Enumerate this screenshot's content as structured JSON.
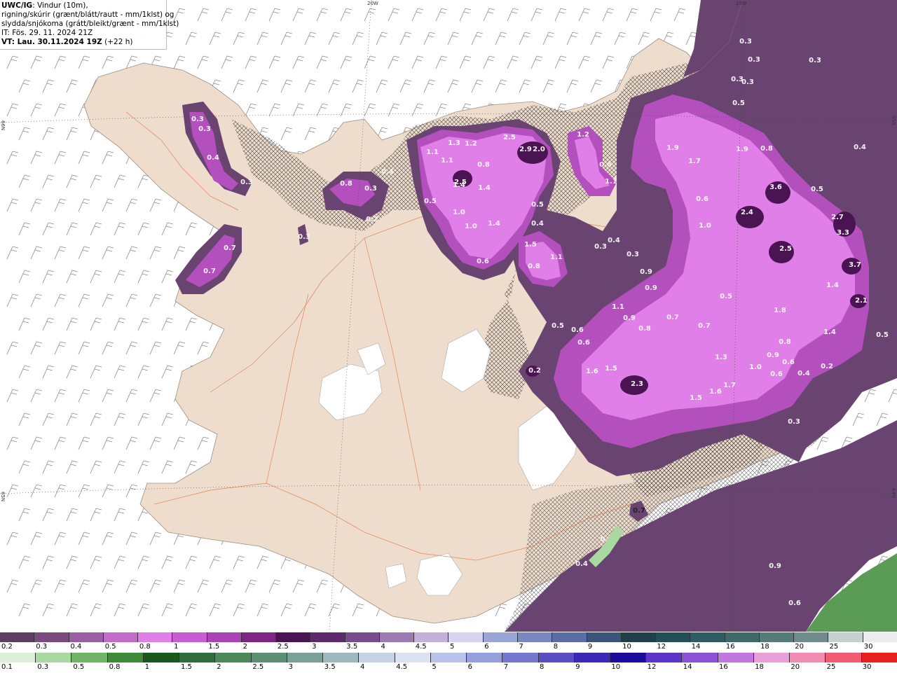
{
  "header": {
    "line1_bold": "UWC/IG",
    "line1_rest": ": Vindur (10m),",
    "line2": "rigning/skúrir (grænt/blátt/rautt - mm/1klst) og",
    "line3": "slydda/snjókoma (grátt/bleikt/grænt - mm/1klst)",
    "line4": "IT: Fös. 29. 11. 2024 21Z",
    "line5_bold": "VT: Lau. 30.11.2024 19Z",
    "line5_rest": " (+22 h)"
  },
  "graticule": {
    "top": [
      "20W",
      "15W"
    ],
    "left": [
      "66N",
      "65N"
    ],
    "right": [
      "65N",
      "64N"
    ]
  },
  "legend": {
    "top_labels": [
      "0.2",
      "0.3",
      "0.4",
      "0.5",
      "0.8",
      "1",
      "1.5",
      "2",
      "2.5",
      "3",
      "3.5",
      "4",
      "4.5",
      "5",
      "6",
      "7",
      "8",
      "9",
      "10",
      "12",
      "14",
      "16",
      "18",
      "20",
      "25",
      "30"
    ],
    "top_colors": [
      "#5e3d62",
      "#7a4b7f",
      "#9a5fa0",
      "#c36dcb",
      "#e07fe8",
      "#c65ed3",
      "#a944b6",
      "#7e2685",
      "#4a1452",
      "#5d2a6b",
      "#7a4c8d",
      "#9b7bb2",
      "#c3b0db",
      "#d9d2f0",
      "#9aa6d6",
      "#7b87c0",
      "#5b6da6",
      "#3c5479",
      "#203f4a",
      "#244f59",
      "#2f5d63",
      "#406a6a",
      "#577a7a",
      "#708b8b",
      "#c7cfcf",
      "#e9eded"
    ],
    "bottom_labels": [
      "0.1",
      "0.3",
      "0.5",
      "0.8",
      "1",
      "1.5",
      "2",
      "2.5",
      "3",
      "3.5",
      "4",
      "4.5",
      "5",
      "6",
      "7",
      "8",
      "9",
      "10",
      "12",
      "14",
      "16",
      "18",
      "20",
      "25",
      "30"
    ],
    "bottom_colors": [
      "#dff0d8",
      "#a9d8a0",
      "#6fb565",
      "#3e8a38",
      "#195a1c",
      "#2f6e3a",
      "#4b8a58",
      "#5e8f75",
      "#7aa097",
      "#9fb8bd",
      "#c4d3e2",
      "#dbe2f1",
      "#b9c2ea",
      "#959fde",
      "#7377cf",
      "#5a4fc2",
      "#3a2ab5",
      "#1b0c9e",
      "#5a35c7",
      "#8d50d8",
      "#c277e0",
      "#e8a0d8",
      "#f08db0",
      "#f05c72",
      "#e8201e"
    ]
  },
  "precip_labels": [
    "0.3",
    "0.3",
    "0.4",
    "0.3",
    "0.7",
    "0.7",
    "0.3",
    "0.8",
    "0.3",
    "0.4",
    "0.2",
    "1.1",
    "1.3",
    "1.2",
    "1.1",
    "2.5",
    "2.9",
    "2.0",
    "0.8",
    "2.5",
    "1.4",
    "1.0",
    "0.5",
    "1.0",
    "1.4",
    "0.6",
    "1.4",
    "0.5",
    "0.4",
    "1.5",
    "1.1",
    "0.8",
    "1.2",
    "0.6",
    "1.1",
    "0.3",
    "0.4",
    "0.3",
    "1.9",
    "1.9",
    "0.8",
    "1.7",
    "0.3",
    "0.3",
    "0.3",
    "0.3",
    "0.3",
    "0.5",
    "0.4",
    "0.5",
    "0.6",
    "1.0",
    "3.6",
    "2.4",
    "2.7",
    "3.3",
    "2.5",
    "3.7",
    "1.4",
    "2.1",
    "0.9",
    "0.9",
    "1.1",
    "0.9",
    "0.8",
    "0.7",
    "0.5",
    "0.7",
    "1.8",
    "0.5",
    "0.6",
    "0.6",
    "0.2",
    "1.6",
    "1.5",
    "2.3",
    "1.5",
    "1.6",
    "1.7",
    "1.3",
    "0.9",
    "1.0",
    "0.8",
    "0.6",
    "1.4",
    "0.6",
    "0.4",
    "0.5",
    "0.2",
    "0.3",
    "0",
    "0.4",
    "0.9",
    "0.6",
    "0.7"
  ]
}
